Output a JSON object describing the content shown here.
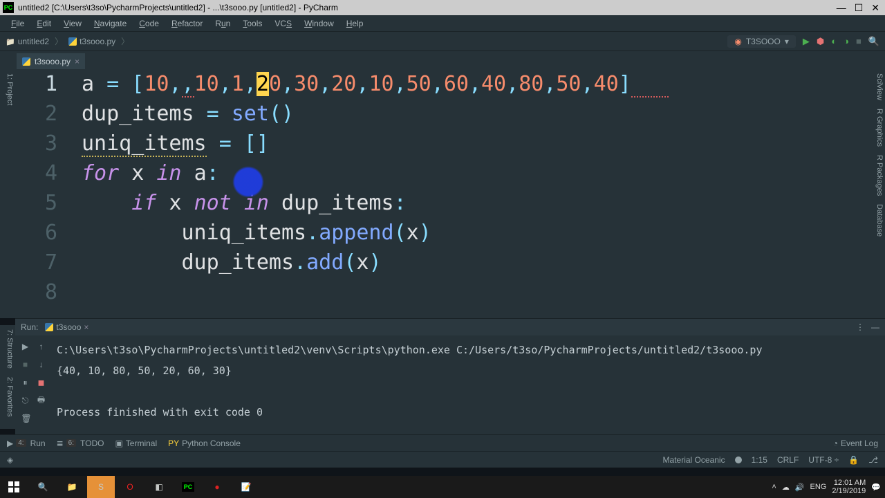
{
  "window": {
    "title": "untitled2 [C:\\Users\\t3so\\PycharmProjects\\untitled2] - ...\\t3sooo.py [untitled2] - PyCharm"
  },
  "menu": {
    "file": "File",
    "edit": "Edit",
    "view": "View",
    "navigate": "Navigate",
    "code": "Code",
    "refactor": "Refactor",
    "run": "Run",
    "tools": "Tools",
    "vcs": "VCS",
    "window": "Window",
    "help": "Help"
  },
  "breadcrumb": {
    "project": "untitled2",
    "file": "t3sooo.py"
  },
  "run_config": {
    "name": "T3SOOO"
  },
  "tab": {
    "name": "t3sooo.py"
  },
  "gutter_left": {
    "project": "1: Project"
  },
  "gutter_right": {
    "sciview": "SciView",
    "rgraphics": "R Graphics",
    "rpackages": "R Packages",
    "database": "Database"
  },
  "left_tools": {
    "structure": "7: Structure",
    "favorites": "2: Favorites"
  },
  "code_lines": {
    "l1": "1",
    "l2": "2",
    "l3": "3",
    "l4": "4",
    "l5": "5",
    "l6": "6",
    "l7": "7",
    "l8": "8"
  },
  "run_panel": {
    "label": "Run:",
    "tab": "t3sooo",
    "cmd": "C:\\Users\\t3so\\PycharmProjects\\untitled2\\venv\\Scripts\\python.exe C:/Users/t3so/PycharmProjects/untitled2/t3sooo.py",
    "output": "{40, 10, 80, 50, 20, 60, 30}",
    "exit": "Process finished with exit code 0"
  },
  "bottom_bar": {
    "run": "4: Run",
    "todo": "6: TODO",
    "terminal": "Terminal",
    "pyconsole": "Python Console",
    "eventlog": "Event Log"
  },
  "status": {
    "theme": "Material Oceanic",
    "pos": "1:15",
    "crlf": "CRLF",
    "enc": "UTF-8",
    "padlock": "🔒"
  },
  "systray": {
    "lang": "ENG",
    "time": "12:01 AM",
    "date": "2/19/2019"
  }
}
